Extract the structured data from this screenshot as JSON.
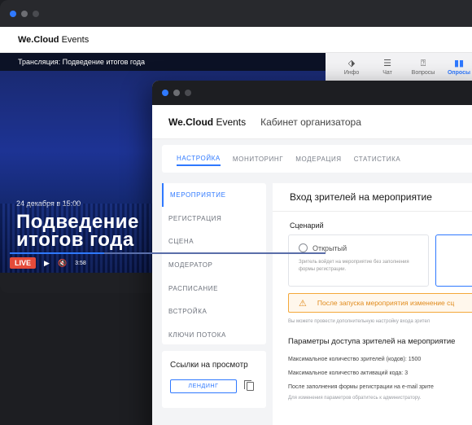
{
  "back": {
    "brand_bold": "We.Cloud",
    "brand_rest": " Events",
    "stream_title": "Трансляция: Подведение итогов года",
    "video": {
      "date": "24 декабря в 15:00",
      "title": "Подведение\nитогов года",
      "live": "LIVE",
      "time": "3:58",
      "progress": 0.3
    },
    "tabs": [
      {
        "label": "Инфо",
        "icon": "tag-icon"
      },
      {
        "label": "Чат",
        "icon": "chat-icon"
      },
      {
        "label": "Вопросы",
        "icon": "question-icon"
      },
      {
        "label": "Опросы",
        "icon": "poll-icon"
      }
    ]
  },
  "front": {
    "brand_bold": "We.Cloud",
    "brand_rest": " Events",
    "cabinet": "Кабинет организатора",
    "nav_tabs": [
      "НАСТРОЙКА",
      "МОНИТОРИНГ",
      "МОДЕРАЦИЯ",
      "СТАТИСТИКА"
    ],
    "sidebar": [
      "МЕРОПРИЯТИЕ",
      "РЕГИСТРАЦИЯ",
      "СЦЕНА",
      "МОДЕРАТОР",
      "РАСПИСАНИЕ",
      "ВСТРОЙКА",
      "КЛЮЧИ ПОТОКА"
    ],
    "links": {
      "title": "Ссылки на просмотр",
      "button": "ЛЕНДИНГ"
    },
    "main": {
      "title": "Вход зрителей на мероприятие",
      "scenario_label": "Сценарий",
      "option_open": {
        "name": "Открытый",
        "desc": "Зритель войдет на мероприятие без заполнения формы регистрации."
      },
      "warning": "После запуска мероприятия изменение сц",
      "muted_line": "Вы можете провести дополнительную настройку входа зрител",
      "params_title": "Параметры доступа зрителей на мероприятие",
      "params": [
        "Максимальное количество зрителей (кодов): 1500",
        "Максимальное количество активаций кода: 3",
        "После заполнения формы регистрации на e-mail зрите"
      ],
      "param_note": "Для изменения параметров обратитесь к администратору."
    }
  },
  "colors": {
    "accent": "#2f79ff",
    "live": "#e54b3a",
    "warning": "#e08a1b"
  }
}
